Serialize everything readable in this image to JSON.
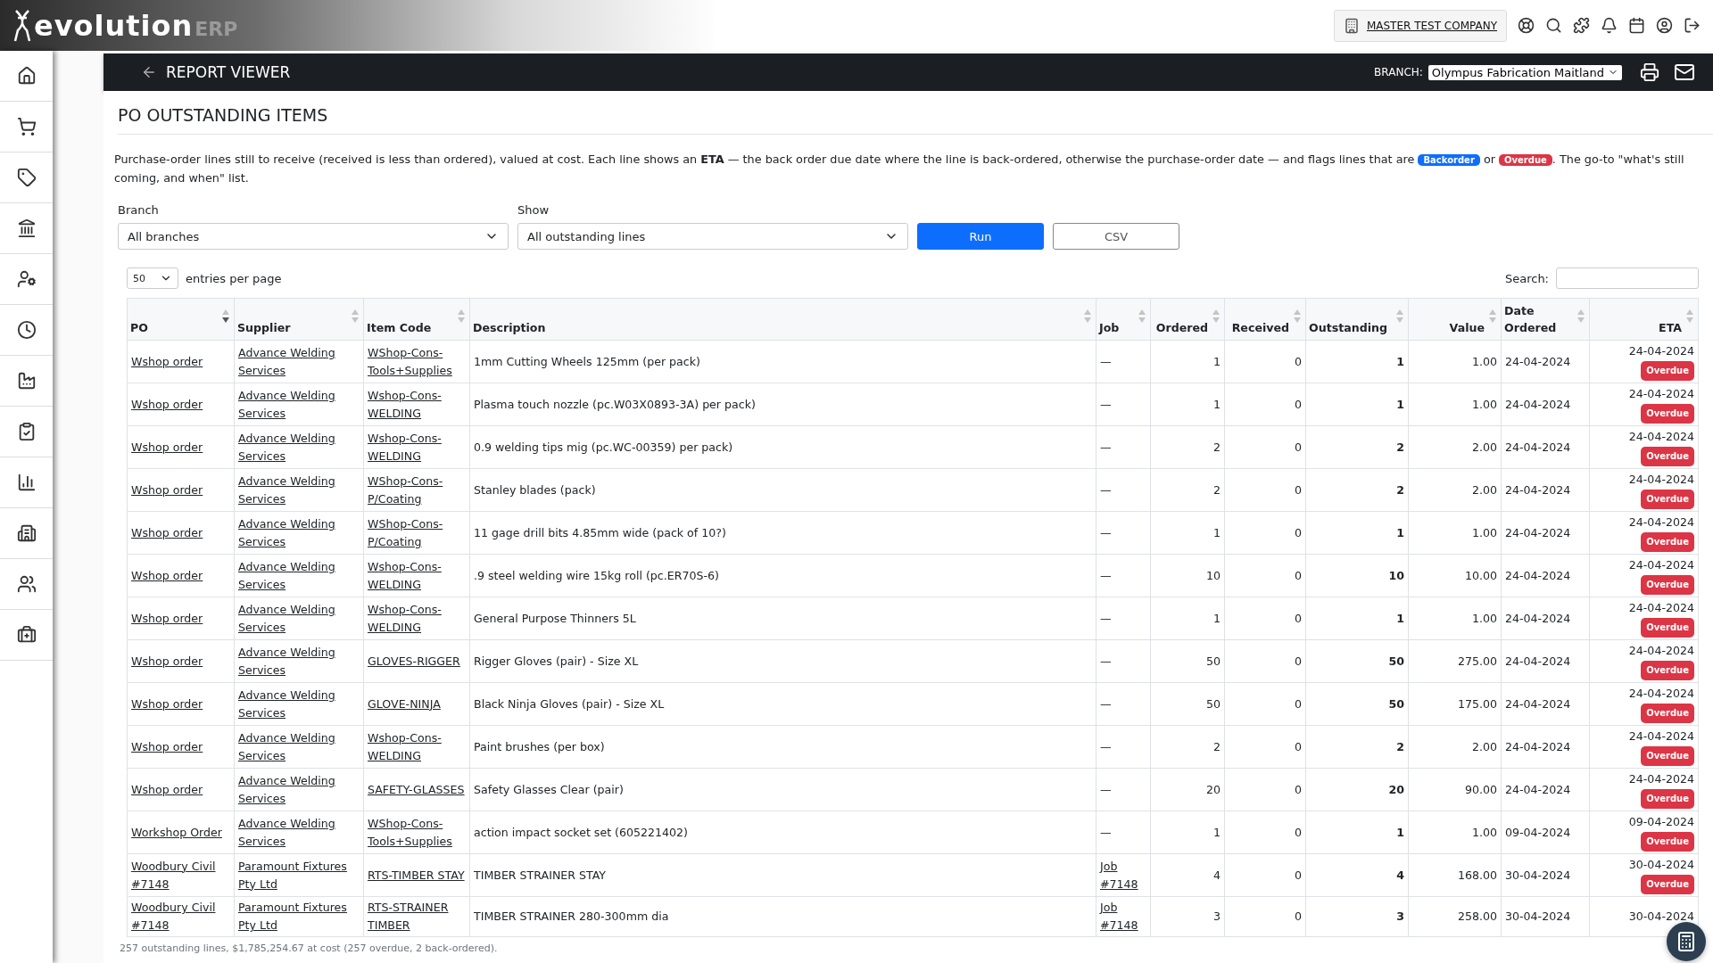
{
  "logo": {
    "name": "evolution",
    "suffix": "ERP"
  },
  "company": {
    "name": "MASTER TEST COMPANY"
  },
  "report_bar": {
    "title": "REPORT VIEWER",
    "branch_label": "BRANCH:",
    "branch_value": "Olympus Fabrication Maitland"
  },
  "page_title": "PO OUTSTANDING ITEMS",
  "description": [
    {
      "kind": "text",
      "text": "Purchase-order lines still to receive (received is less than ordered), valued at cost. Each line shows an **ETA** — the back order due date where the line is back-ordered, otherwise the purchase-order date — and flags lines that are "
    },
    {
      "kind": "badge",
      "text": "Backorder",
      "color": "#0d6efd"
    },
    {
      "kind": "text",
      "text": " or "
    },
    {
      "kind": "badge",
      "text": "Overdue",
      "color": "#dc3545"
    },
    {
      "kind": "text",
      "text": ". The go-to \"what's still coming, and when\" list."
    }
  ],
  "filters": [
    {
      "label": "Branch",
      "value": "All branches"
    },
    {
      "label": "Show",
      "value": "All outstanding lines"
    }
  ],
  "buttons": [
    {
      "kind": "primary",
      "label": "Run"
    },
    {
      "kind": "outline",
      "label": "CSV"
    }
  ],
  "page_size": {
    "value": "50",
    "label": "entries per page"
  },
  "search": {
    "label": "Search:"
  },
  "table": {
    "columns": [
      {
        "label": "PO",
        "sorted": true
      },
      {
        "label": "Supplier",
        "sorted": false
      },
      {
        "label": "Item Code",
        "sorted": false
      },
      {
        "label": "Description",
        "sorted": false
      },
      {
        "label": "Job",
        "sorted": false
      },
      {
        "label": "Ordered",
        "sorted": false
      },
      {
        "label": "Received",
        "sorted": false
      },
      {
        "label": "Outstanding",
        "sorted": false
      },
      {
        "label": "Value",
        "sorted": false
      },
      {
        "label": "Date Ordered",
        "sorted": false
      },
      {
        "label": "ETA",
        "sorted": false
      }
    ],
    "rows": [
      {
        "po": "Wshop order",
        "supplier": "Advance Welding Services",
        "item_code": "WShop-Cons-Tools+Supplies",
        "description": "1mm Cutting Wheels 125mm (per pack)",
        "job": "—",
        "ordered": "1",
        "received": "0",
        "outstanding": "1",
        "value": "1.00",
        "date_ordered": "24-04-2024",
        "eta": "24-04-2024",
        "flag": "Overdue"
      },
      {
        "po": "Wshop order",
        "supplier": "Advance Welding Services",
        "item_code": "Wshop-Cons-WELDING",
        "description": "Plasma touch nozzle (pc.W03X0893-3A) per pack)",
        "job": "—",
        "ordered": "1",
        "received": "0",
        "outstanding": "1",
        "value": "1.00",
        "date_ordered": "24-04-2024",
        "eta": "24-04-2024",
        "flag": "Overdue"
      },
      {
        "po": "Wshop order",
        "supplier": "Advance Welding Services",
        "item_code": "Wshop-Cons-WELDING",
        "description": "0.9 welding tips mig (pc.WC-00359) per pack)",
        "job": "—",
        "ordered": "2",
        "received": "0",
        "outstanding": "2",
        "value": "2.00",
        "date_ordered": "24-04-2024",
        "eta": "24-04-2024",
        "flag": "Overdue"
      },
      {
        "po": "Wshop order",
        "supplier": "Advance Welding Services",
        "item_code": "WShop-Cons-P/Coating",
        "description": "Stanley blades (pack)",
        "job": "—",
        "ordered": "2",
        "received": "0",
        "outstanding": "2",
        "value": "2.00",
        "date_ordered": "24-04-2024",
        "eta": "24-04-2024",
        "flag": "Overdue"
      },
      {
        "po": "Wshop order",
        "supplier": "Advance Welding Services",
        "item_code": "WShop-Cons-P/Coating",
        "description": "11 gage drill bits 4.85mm wide (pack of 10?)",
        "job": "—",
        "ordered": "1",
        "received": "0",
        "outstanding": "1",
        "value": "1.00",
        "date_ordered": "24-04-2024",
        "eta": "24-04-2024",
        "flag": "Overdue"
      },
      {
        "po": "Wshop order",
        "supplier": "Advance Welding Services",
        "item_code": "Wshop-Cons-WELDING",
        "description": ".9 steel welding wire 15kg roll (pc.ER70S-6)",
        "job": "—",
        "ordered": "10",
        "received": "0",
        "outstanding": "10",
        "value": "10.00",
        "date_ordered": "24-04-2024",
        "eta": "24-04-2024",
        "flag": "Overdue"
      },
      {
        "po": "Wshop order",
        "supplier": "Advance Welding Services",
        "item_code": "Wshop-Cons-WELDING",
        "description": "General Purpose Thinners 5L",
        "job": "—",
        "ordered": "1",
        "received": "0",
        "outstanding": "1",
        "value": "1.00",
        "date_ordered": "24-04-2024",
        "eta": "24-04-2024",
        "flag": "Overdue"
      },
      {
        "po": "Wshop order",
        "supplier": "Advance Welding Services",
        "item_code": "GLOVES-RIGGER",
        "description": "Rigger Gloves (pair) - Size XL",
        "job": "—",
        "ordered": "50",
        "received": "0",
        "outstanding": "50",
        "value": "275.00",
        "date_ordered": "24-04-2024",
        "eta": "24-04-2024",
        "flag": "Overdue"
      },
      {
        "po": "Wshop order",
        "supplier": "Advance Welding Services",
        "item_code": "GLOVE-NINJA",
        "description": "Black Ninja Gloves (pair) - Size XL",
        "job": "—",
        "ordered": "50",
        "received": "0",
        "outstanding": "50",
        "value": "175.00",
        "date_ordered": "24-04-2024",
        "eta": "24-04-2024",
        "flag": "Overdue"
      },
      {
        "po": "Wshop order",
        "supplier": "Advance Welding Services",
        "item_code": "Wshop-Cons-WELDING",
        "description": "Paint brushes (per box)",
        "job": "—",
        "ordered": "2",
        "received": "0",
        "outstanding": "2",
        "value": "2.00",
        "date_ordered": "24-04-2024",
        "eta": "24-04-2024",
        "flag": "Overdue"
      },
      {
        "po": "Wshop order",
        "supplier": "Advance Welding Services",
        "item_code": "SAFETY-GLASSES",
        "description": "Safety Glasses Clear (pair)",
        "job": "—",
        "ordered": "20",
        "received": "0",
        "outstanding": "20",
        "value": "90.00",
        "date_ordered": "24-04-2024",
        "eta": "24-04-2024",
        "flag": "Overdue"
      },
      {
        "po": "Workshop Order",
        "supplier": "Advance Welding Services",
        "item_code": "WShop-Cons-Tools+Supplies",
        "description": "action impact socket set (605221402)",
        "job": "—",
        "ordered": "1",
        "received": "0",
        "outstanding": "1",
        "value": "1.00",
        "date_ordered": "09-04-2024",
        "eta": "09-04-2024",
        "flag": "Overdue"
      },
      {
        "po": "Woodbury Civil #7148",
        "supplier": "Paramount Fixtures Pty Ltd",
        "item_code": "RTS-TIMBER STAY",
        "description": "TIMBER STRAINER STAY",
        "job": "Job #7148",
        "ordered": "4",
        "received": "0",
        "outstanding": "4",
        "value": "168.00",
        "date_ordered": "30-04-2024",
        "eta": "30-04-2024",
        "flag": "Overdue"
      },
      {
        "po": "Woodbury Civil #7148",
        "supplier": "Paramount Fixtures Pty Ltd",
        "item_code": "RTS-STRAINER TIMBER",
        "description": "TIMBER STRAINER 280-300mm dia",
        "job": "Job #7148",
        "ordered": "3",
        "received": "0",
        "outstanding": "3",
        "value": "258.00",
        "date_ordered": "30-04-2024",
        "eta": "30-04-2024"
      }
    ]
  },
  "summary": "257 outstanding lines, $1,785,254.67 at cost (257 overdue, 2 back-ordered)."
}
